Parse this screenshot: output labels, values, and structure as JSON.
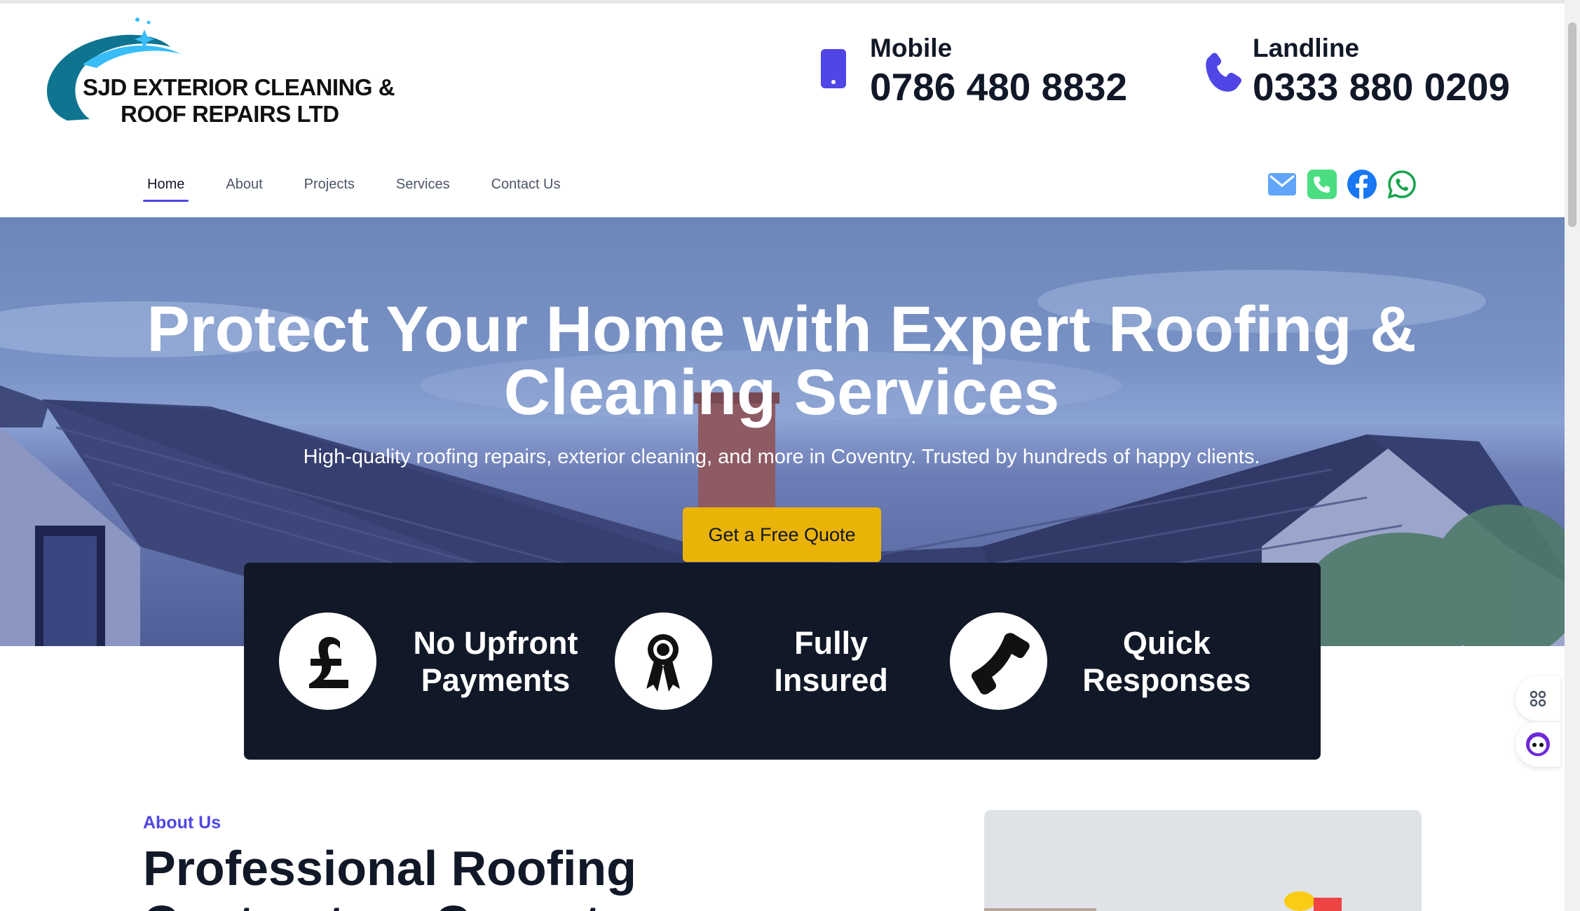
{
  "brand": {
    "name_line1": "SJD EXTERIOR CLEANING &",
    "name_line2": "ROOF REPAIRS  LTD"
  },
  "contacts": {
    "mobile": {
      "label": "Mobile",
      "number": "0786 480 8832",
      "icon": "mobile-phone-icon"
    },
    "landline": {
      "label": "Landline",
      "number": "0333 880 0209",
      "icon": "phone-handset-icon"
    }
  },
  "nav": {
    "items": [
      {
        "label": "Home",
        "active": true
      },
      {
        "label": "About",
        "active": false
      },
      {
        "label": "Projects",
        "active": false
      },
      {
        "label": "Services",
        "active": false
      },
      {
        "label": "Contact Us",
        "active": false
      }
    ]
  },
  "socials": [
    "email-icon",
    "phone-icon",
    "facebook-icon",
    "whatsapp-icon"
  ],
  "hero": {
    "title": "Protect Your Home with Expert Roofing & Cleaning Services",
    "subtitle": "High-quality roofing repairs, exterior cleaning, and more in Coventry. Trusted by hundreds of happy clients.",
    "cta_label": "Get a Free Quote"
  },
  "features": [
    {
      "text": "No Upfront Payments",
      "icon": "pound-icon"
    },
    {
      "text": "Fully Insured",
      "icon": "award-ribbon-icon"
    },
    {
      "text": "Quick Responses",
      "icon": "phone-icon"
    }
  ],
  "about": {
    "kicker": "About Us",
    "title": "Professional Roofing Contractors Coventry"
  },
  "colors": {
    "accent": "#4f46e5",
    "cta": "#eab308",
    "feature_bg": "#111827"
  }
}
